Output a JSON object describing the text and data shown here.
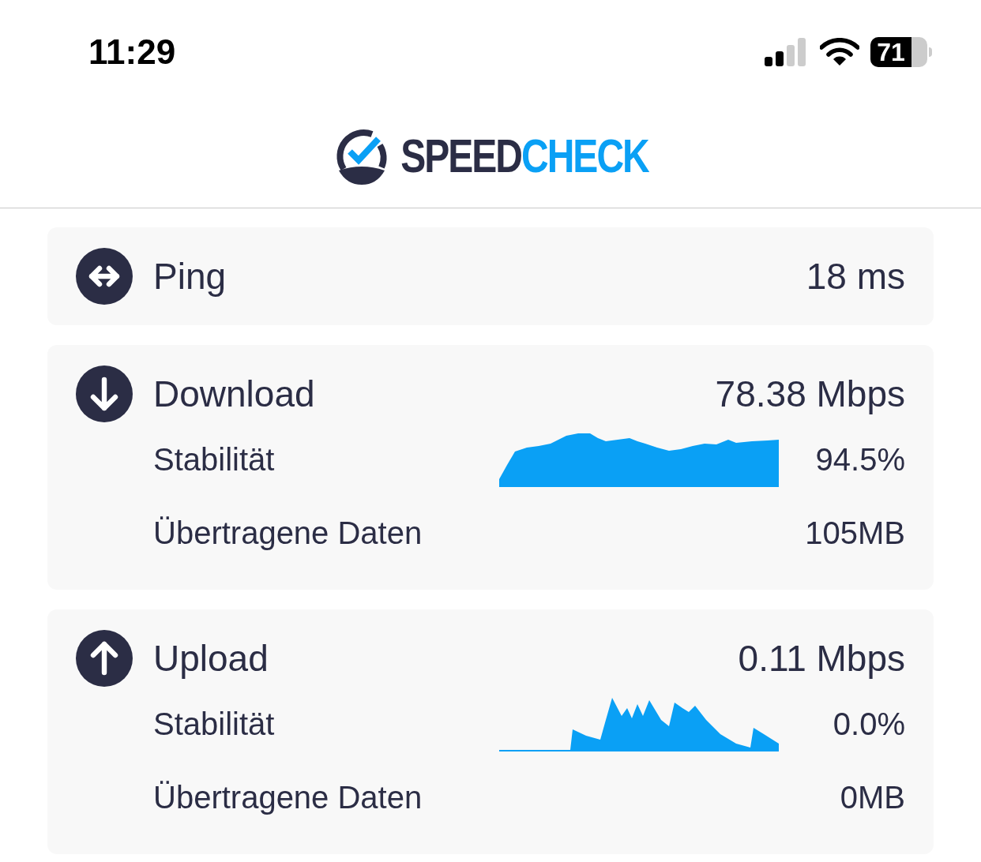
{
  "status_bar": {
    "time": "11:29",
    "battery": "71"
  },
  "header": {
    "logo_primary": "SPEED",
    "logo_accent": "CHECK"
  },
  "metrics": [
    {
      "kind": "ping",
      "label": "Ping",
      "value": "18 ms"
    },
    {
      "kind": "download",
      "label": "Download",
      "value": "78.38 Mbps",
      "details": [
        {
          "kind": "stability",
          "label": "Stabilität",
          "value": "94.5%"
        },
        {
          "kind": "data",
          "label": "Übertragene Daten",
          "value": "105MB"
        }
      ]
    },
    {
      "kind": "upload",
      "label": "Upload",
      "value": "0.11 Mbps",
      "details": [
        {
          "kind": "stability",
          "label": "Stabilität",
          "value": "0.0%"
        },
        {
          "kind": "data",
          "label": "Übertragene Daten",
          "value": "0MB"
        }
      ]
    }
  ]
}
